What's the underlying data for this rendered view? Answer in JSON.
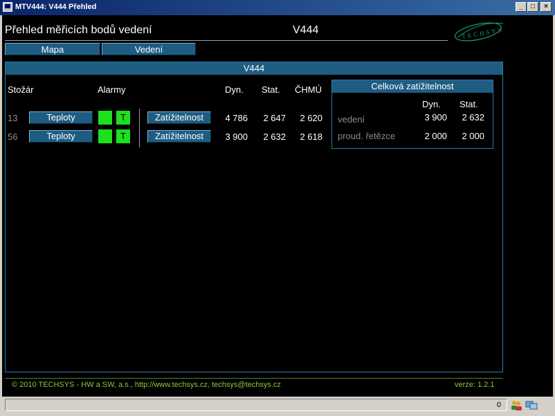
{
  "window": {
    "title": "MTV444: V444 Přehled"
  },
  "header": {
    "title": "Přehled měřicích bodů vedení",
    "code": "V444",
    "logo_text": "TECHSYS"
  },
  "nav": {
    "tabs": [
      {
        "label": "Mapa"
      },
      {
        "label": "Vedení"
      }
    ]
  },
  "panel": {
    "heading": "V444",
    "columns": {
      "tower": "Stožár",
      "alarms": "Alarmy",
      "dyn": "Dyn.",
      "stat": "Stat.",
      "chmu": "ČHMÚ"
    },
    "rows": [
      {
        "tower": "13",
        "temps_label": "Teploty",
        "alarm_t": "T",
        "load_label": "Zatížitelnost",
        "dyn": "4 786",
        "stat": "2 647",
        "chmu": "2 620"
      },
      {
        "tower": "56",
        "temps_label": "Teploty",
        "alarm_t": "T",
        "load_label": "Zatížitelnost",
        "dyn": "3 900",
        "stat": "2 632",
        "chmu": "2 618"
      }
    ],
    "summary": {
      "heading": "Celková zatížitelnost",
      "col_dyn": "Dyn.",
      "col_stat": "Stat.",
      "rows": [
        {
          "label": "vedení",
          "dyn": "3 900",
          "stat": "2 632"
        },
        {
          "label": "proud. řetězce",
          "dyn": "2 000",
          "stat": "2 000"
        }
      ]
    }
  },
  "footer": {
    "copyright": "© 2010 TECHSYS - HW a SW, a.s.,  http://www.techsys.cz,  techsys@techsys.cz",
    "version": "verze:  1.2.1"
  },
  "statusbar": {
    "counter": "0"
  },
  "colors": {
    "panel_blue": "#1e5c82",
    "alarm_green": "#1ce01c",
    "footer_green": "#8cc83c"
  }
}
